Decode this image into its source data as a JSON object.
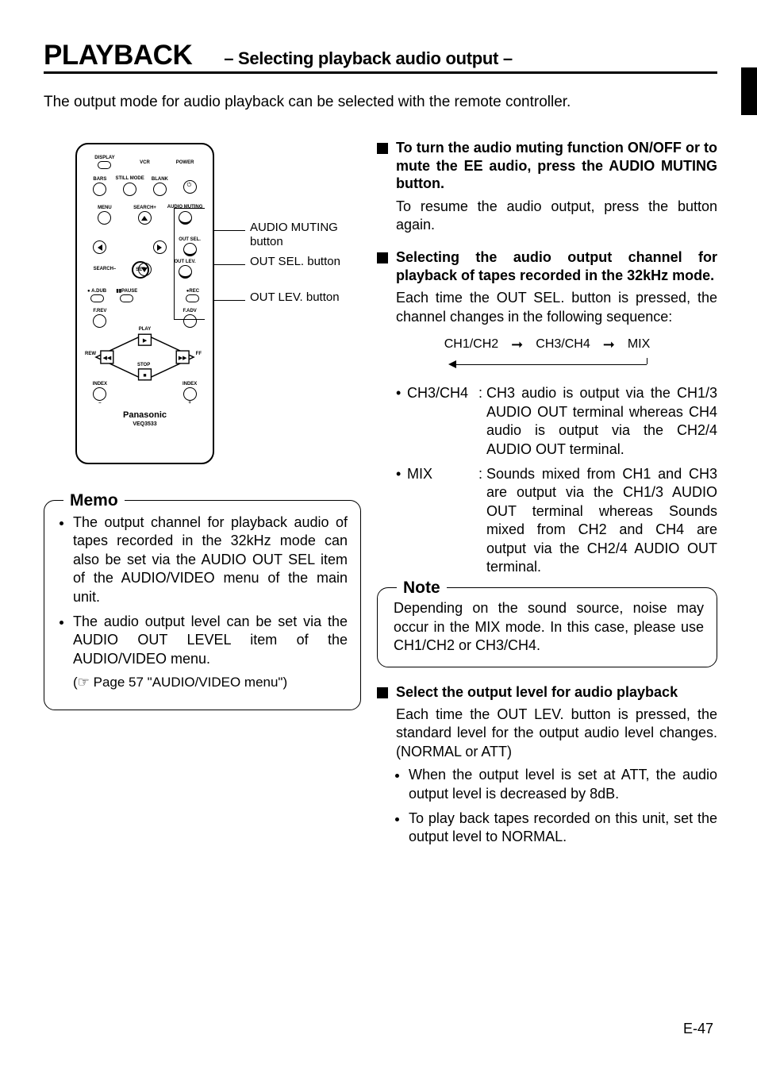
{
  "title": {
    "main": "PLAYBACK",
    "sub": "– Selecting playback audio output –"
  },
  "intro": "The output mode for audio playback can be selected with the remote controller.",
  "remote": {
    "labels": {
      "display": "DISPLAY",
      "vcr": "VCR",
      "power": "POWER",
      "bars": "BARS",
      "still_mode": "STILL MODE",
      "blank": "BLANK",
      "menu": "MENU",
      "search_plus": "SEARCH+",
      "audio_muting": "AUDIO MUTING",
      "out_sel": "OUT SEL.",
      "out_lev": "OUT LEV.",
      "search_minus": "SEARCH–",
      "set": "SET",
      "adub": "A.DUB",
      "pause": "PAUSE",
      "rec": "REC",
      "frev": "F.REV",
      "fadv": "F.ADV",
      "play": "PLAY",
      "rew": "REW",
      "ff": "FF",
      "stop": "STOP",
      "index_minus": "INDEX",
      "index_plus": "INDEX",
      "minus": "–",
      "plus": "+"
    },
    "brand": "Panasonic",
    "model": "VEQ3533"
  },
  "callouts": {
    "audio_muting": "AUDIO MUTING button",
    "out_sel": "OUT SEL. button",
    "out_lev": "OUT LEV. button"
  },
  "memo": {
    "title": "Memo",
    "items": [
      "The output channel for playback audio of tapes recorded in the 32kHz mode can also be set via the AUDIO OUT SEL item of the AUDIO/VIDEO menu of the main unit.",
      "The audio output level can be set via the AUDIO OUT LEVEL item of the AUDIO/VIDEO menu."
    ],
    "ref": "(☞ Page 57 \"AUDIO/VIDEO menu\")"
  },
  "sections": {
    "muting": {
      "title": "To turn the audio muting function ON/OFF or to mute the EE audio, press the AUDIO MUTING button.",
      "body": "To resume the audio output, press the button again."
    },
    "channel": {
      "title": "Selecting the audio output channel for playback of tapes recorded in the 32kHz mode.",
      "body": "Each time the OUT SEL. button is pressed, the channel changes in the following sequence:",
      "sequence": [
        "CH1/CH2",
        "CH3/CH4",
        "MIX"
      ],
      "defs": [
        {
          "term": "CH3/CH4",
          "desc": "CH3 audio is output via the CH1/3 AUDIO OUT terminal whereas CH4 audio is output via the CH2/4 AUDIO OUT terminal."
        },
        {
          "term": "MIX",
          "desc": "Sounds mixed from CH1 and CH3 are output via the CH1/3 AUDIO OUT terminal whereas Sounds mixed from CH2 and CH4 are output via the CH2/4 AUDIO OUT terminal."
        }
      ]
    },
    "note": {
      "title": "Note",
      "body": "Depending on the sound source, noise may occur in the MIX mode. In this case, please use CH1/CH2 or CH3/CH4."
    },
    "level": {
      "title": "Select the output level for audio playback",
      "body": "Each time the OUT LEV. button is pressed, the standard level for the output audio level changes. (NORMAL or ATT)",
      "bullets": [
        "When the output level is set at ATT, the audio output level is decreased by 8dB.",
        "To play back tapes recorded on this unit, set the output level to NORMAL."
      ]
    }
  },
  "page_number": "E-47"
}
